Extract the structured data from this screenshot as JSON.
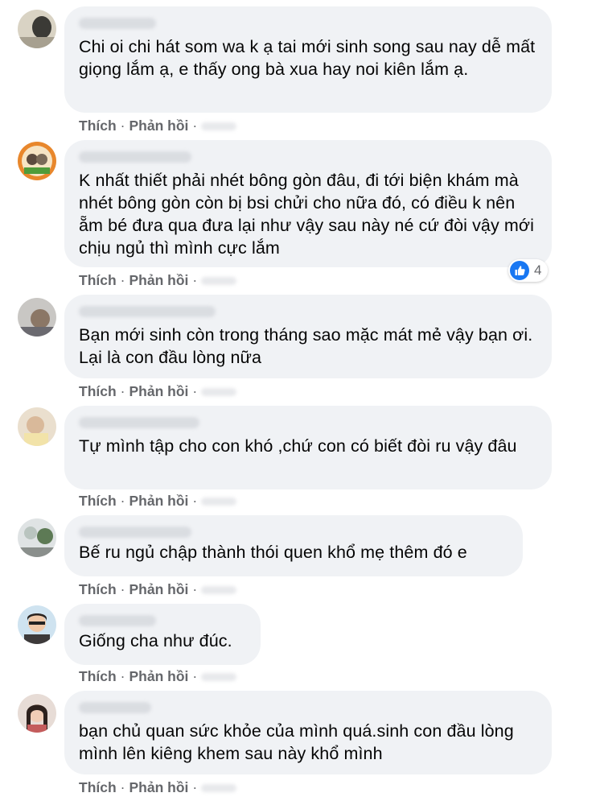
{
  "labels": {
    "like": "Thích",
    "reply": "Phản hồi",
    "separator": "·"
  },
  "colors": {
    "bubble": "#f0f2f5",
    "action_text": "#65676b",
    "like_blue": "#1877f2"
  },
  "comments": [
    {
      "text": "Chi oi chi hát som wa k ạ tai mới sinh song sau nay dễ mất giọng lắm ạ, e thấy ong bà xua hay noi kiên lắm ạ."
    },
    {
      "text": "K nhất thiết phải nhét bông gòn đâu, đi tới biện khám mà nhét bông gòn còn bị bsi chửi cho nữa đó, có điều k nên ẵm bé đưa qua đưa lại như vậy sau này né cứ đòi vậy mới chịu ngủ thì mình cực lắm",
      "reaction": {
        "icon": "like-icon",
        "count": "4"
      }
    },
    {
      "text": "Bạn mới sinh còn trong tháng sao mặc mát mẻ vậy bạn ơi. Lại là con đầu lòng nữa"
    },
    {
      "text": "Tự mình tập cho con khó ,chứ con có biết đòi ru vậy đâu"
    },
    {
      "text": "Bế ru ngủ chập thành thói quen khổ mẹ thêm đó e"
    },
    {
      "text": "Giống cha như đúc."
    },
    {
      "text": "bạn chủ quan sức khỏe của mình quá.sinh con đầu lòng mình lên kiêng khem sau này khổ mình"
    }
  ]
}
